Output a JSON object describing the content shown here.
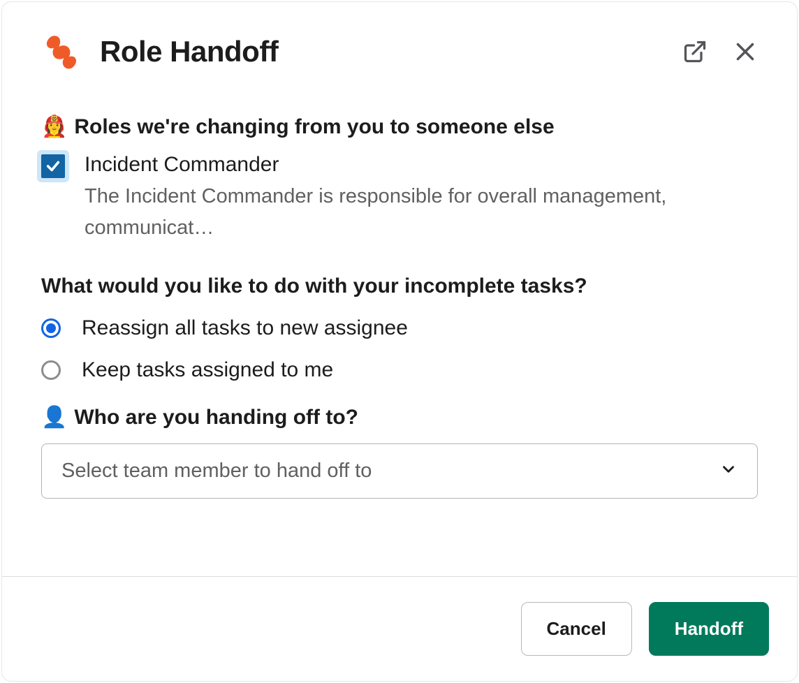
{
  "header": {
    "title": "Role Handoff"
  },
  "section_roles": {
    "emoji": "👩‍🚒",
    "title": "Roles we're changing from you to someone else"
  },
  "roles": [
    {
      "checked": true,
      "name": "Incident Commander",
      "description": "The Incident Commander is responsible for overall management, communicat…"
    }
  ],
  "tasks_question": "What would you like to do with your incomplete tasks?",
  "task_options": [
    {
      "label": "Reassign all tasks to new assignee",
      "selected": true
    },
    {
      "label": "Keep tasks assigned to me",
      "selected": false
    }
  ],
  "handoff_target": {
    "emoji": "👤",
    "title": "Who are you handing off to?",
    "placeholder": "Select team member to hand off to"
  },
  "footer": {
    "cancel": "Cancel",
    "submit": "Handoff"
  }
}
